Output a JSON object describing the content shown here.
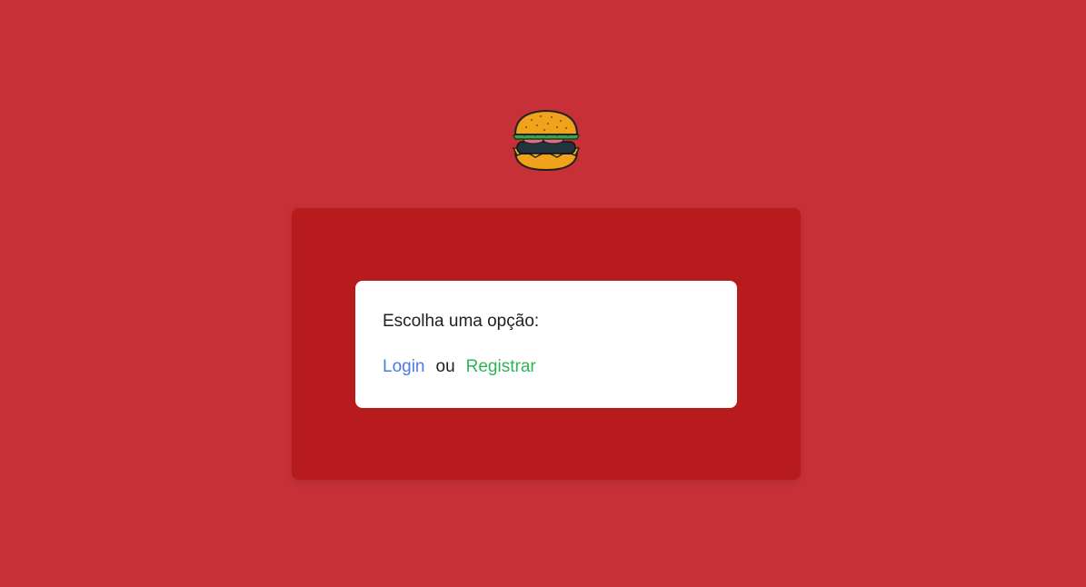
{
  "logo": {
    "icon": "burger-icon"
  },
  "choice_card": {
    "prompt": "Escolha uma opção:",
    "login_label": "Login",
    "separator": "ou",
    "register_label": "Registrar"
  },
  "colors": {
    "background": "#c83038",
    "panel": "#b71b1e",
    "card": "#ffffff",
    "login_link": "#4a7be6",
    "register_link": "#2fb455"
  }
}
